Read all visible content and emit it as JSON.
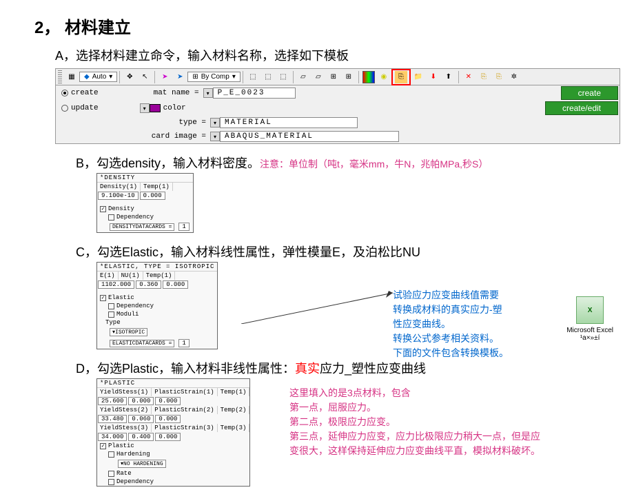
{
  "title": "2， 材料建立",
  "step_a": "A，选择材料建立命令，输入材料名称，选择如下模板",
  "toolbar": {
    "auto": "Auto",
    "bycomp": "By Comp",
    "create_radio": "create",
    "update_radio": "update",
    "matname_lbl": "mat name =",
    "matname_val": "P_E_0023",
    "color_lbl": "color",
    "type_lbl": "type =",
    "type_val": "MATERIAL",
    "card_lbl": "card image =",
    "card_val": "ABAQUS_MATERIAL",
    "btn_create": "create",
    "btn_createedit": "create/edit"
  },
  "step_b": "B，勾选density，输入材料密度。",
  "step_b_note": "注意：单位制（吨t，毫米mm，牛N，兆帕MPa,秒S）",
  "density_panel": {
    "header": "*DENSITY",
    "c1": "Density(1)",
    "c2": "Temp(1)",
    "v1": "9.100e-10",
    "v2": "0.000",
    "ck_density": "Density",
    "ck_dep": "Dependency",
    "ddr": "DENSITYDATACARDS =",
    "ddrv": "1"
  },
  "step_c": "C，勾选Elastic，输入材料线性属性，弹性模量E，及泊松比NU",
  "elastic_panel": {
    "header": "*ELASTIC, TYPE = ISOTROPIC",
    "c1": "E(1)",
    "c2": "NU(1)",
    "c3": "Temp(1)",
    "v1": "1102.000",
    "v2": "0.360",
    "v3": "0.000",
    "ck_elastic": "Elastic",
    "ck_dep": "Dependency",
    "ck_mod": "Moduli",
    "type_lbl": "Type",
    "type_val": "ISOTROPIC",
    "ddr": "ELASTICDATACARDS =",
    "ddrv": "1"
  },
  "elastic_notes": {
    "l1": "试验应力应变曲线值需要",
    "l2": "转换成材料的真实应力-塑",
    "l3": "性应变曲线。",
    "l4": "转换公式参考相关资料。",
    "l5": "下面的文件包含转换模板。"
  },
  "excel": {
    "label": "Microsoft Excel",
    "sub": "¹a×»±í"
  },
  "step_d_pre": "D，勾选Plastic，输入材料非线性属性：",
  "step_d_red": "真实",
  "step_d_post": "应力_塑性应变曲线",
  "plastic_panel": {
    "header": "*PLASTIC",
    "c1": "YieldStess(1)",
    "c2": "PlasticStrain(1)",
    "c3": "Temp(1)",
    "r1v1": "25.600",
    "r1v2": "0.000",
    "r1v3": "0.000",
    "c21": "YieldStess(2)",
    "c22": "PlasticStrain(2)",
    "c23": "Temp(2)",
    "r2v1": "33.480",
    "r2v2": "0.060",
    "r2v3": "0.000",
    "c31": "YieldStess(3)",
    "c32": "PlasticStrain(3)",
    "c33": "Temp(3)",
    "r3v1": "34.000",
    "r3v2": "0.400",
    "r3v3": "0.000",
    "ck_plastic": "Plastic",
    "ck_hard": "Hardening",
    "hard_val": "NO HARDENING",
    "ck_rate": "Rate",
    "ck_dep": "Dependency"
  },
  "plastic_notes": {
    "l1": "这里填入的是3点材料，包含",
    "l2": "第一点，屈服应力。",
    "l3": "第二点，极限应力应变。",
    "l4": "第三点，延伸应力应变，应力比极限应力稍大一点，但是应",
    "l5": "变很大，这样保持延伸应力应变曲线平直，模拟材料破坏。"
  }
}
